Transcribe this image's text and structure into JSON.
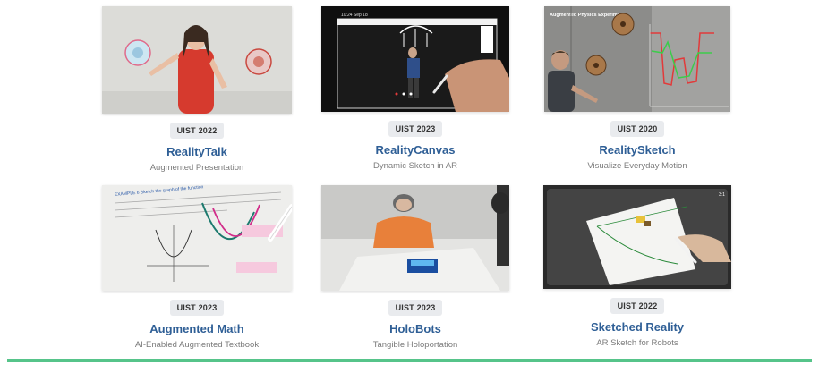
{
  "projects": [
    {
      "venue": "UIST 2022",
      "title": "RealityTalk",
      "subtitle": "Augmented Presentation"
    },
    {
      "venue": "UIST 2023",
      "title": "RealityCanvas",
      "subtitle": "Dynamic Sketch in AR"
    },
    {
      "venue": "UIST 2020",
      "title": "RealitySketch",
      "subtitle": "Visualize Everyday Motion"
    },
    {
      "venue": "UIST 2023",
      "title": "Augmented Math",
      "subtitle": "AI-Enabled Augmented Textbook"
    },
    {
      "venue": "UIST 2023",
      "title": "HoloBots",
      "subtitle": "Tangible Holoportation"
    },
    {
      "venue": "UIST 2022",
      "title": "Sketched Reality",
      "subtitle": "AR Sketch for Robots"
    }
  ],
  "thumb_overlays": {
    "canvas_status": "10:24 Sep 18",
    "sketch_caption": "Augmented Physics Experiment",
    "math_heading": "EXAMPLE 6  Sketch the graph of the function",
    "sketched_time": "3:1"
  },
  "colors": {
    "title": "#2f5f96",
    "badge_bg": "#e9ebee",
    "accent_bar": "#56c48a"
  }
}
